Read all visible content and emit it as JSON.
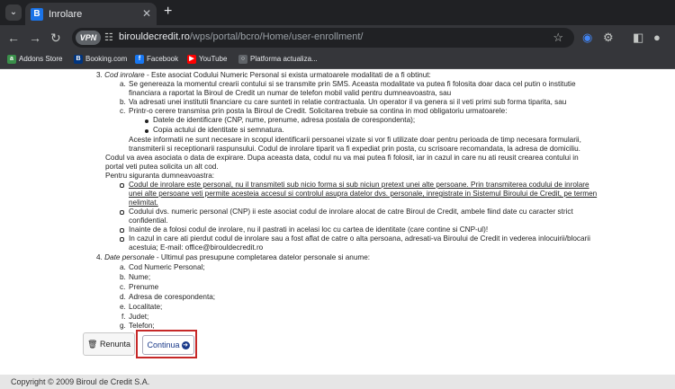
{
  "browser": {
    "tab_title": "Inrolare",
    "new_tab": "+",
    "url_host": "birouldecredit.ro",
    "url_path": "/wps/portal/bcro/Home/user-enrollment/",
    "vpn_label": "VPN",
    "bookmarks": [
      "Addons Store",
      "Booking.com",
      "Facebook",
      "YouTube",
      "Platforma actualiza..."
    ]
  },
  "content": {
    "item3_num": "3.",
    "item3_title": "Cod inrolare",
    "item3_rest": " - Este asociat Codului Numeric Personal si exista urmatoarele modalitati de a fi obtinut:",
    "a_mark": "a.",
    "a1": "Se genereaza la momentul crearii contului si se transmite prin SMS. Aceasta modalitate va putea fi folosita doar daca cel putin o institutie",
    "a2": "financiara a raportat la Biroul de Credit un numar de telefon mobil valid pentru dumneavoastra, sau",
    "b_mark": "b.",
    "b1": "Va adresati unei institutii financiare cu care sunteti in relatie contractuala. Un operator il va genera si il veti primi sub forma tiparita, sau",
    "c_mark": "c.",
    "c1": "Printr-o cerere transmisa prin posta la Biroul de Credit. Solicitarea trebuie sa contina in mod obligatoriu urmatoarele:",
    "c_b1": "Datele de identificare (CNP, nume, prenume, adresa postala de corespondenta);",
    "c_b2": "Copia actului de identitate si semnatura.",
    "p1": "Aceste informatii ne sunt necesare in scopul identificarii persoanei vizate si vor fi utilizate doar pentru perioada de timp necesara formularii,",
    "p2": "transmiterii si receptionarii raspunsului. Codul de inrolare tiparit va fi expediat prin posta, cu scrisoare recomandata, la adresa de domiciliu.",
    "p3": "Codul va avea asociata o data de expirare. Dupa aceasta data, codul nu va mai putea fi folosit, iar in cazul in care nu ati reusit crearea contului in",
    "p4": "portal veti putea solicita un alt cod.",
    "p5": "Pentru siguranta dumneavoastra:",
    "s1a": "Codul de inrolare este personal, nu il transmiteti sub nicio forma si sub niciun pretext unei alte persoane. Prin transmiterea codului de inrolare",
    "s1b": "unei alte persoane veti permite acesteia accesul si controlul asupra datelor dvs. personale, inregistrate in Sistemul Biroului de Credit, pe termen",
    "s1c": "nelimitat.",
    "s2a": "Codului dvs. numeric personal (CNP) ii este asociat codul de inrolare alocat de catre Biroul de Credit, ambele fiind date cu caracter strict",
    "s2b": "confidential.",
    "s3": "Inainte de a folosi codul de inrolare, nu il pastrati in acelasi loc cu cartea de identitate (care contine si CNP-ul)!",
    "s4a": "In cazul in care ati pierdut codul de inrolare sau a fost aflat de catre o alta persoana, adresati-va Biroului de Credit in vederea inlocuirii/blocarii",
    "s4b": "acestuia; E-mail: office@birouldecredit.ro",
    "item4_num": "4.",
    "item4_title": "Date personale",
    "item4_rest": " - Ultimul pas presupune completarea datelor personale si anume:",
    "fields": [
      {
        "mark": "a.",
        "label": "Cod Numeric Personal;"
      },
      {
        "mark": "b.",
        "label": "Nume;"
      },
      {
        "mark": "c.",
        "label": "Prenume"
      },
      {
        "mark": "d.",
        "label": "Adresa de corespondenta;"
      },
      {
        "mark": "e.",
        "label": "Localitate;"
      },
      {
        "mark": "f.",
        "label": "Judet;"
      },
      {
        "mark": "g.",
        "label": "Telefon;"
      }
    ]
  },
  "buttons": {
    "cancel_label": "Renunta",
    "continue_label": "Continua"
  },
  "footer": {
    "copyright": "Copyright © 2009 Biroul de Credit S.A."
  },
  "colors": {
    "highlight_border": "#c62828",
    "link_blue": "#1a3a8a"
  }
}
